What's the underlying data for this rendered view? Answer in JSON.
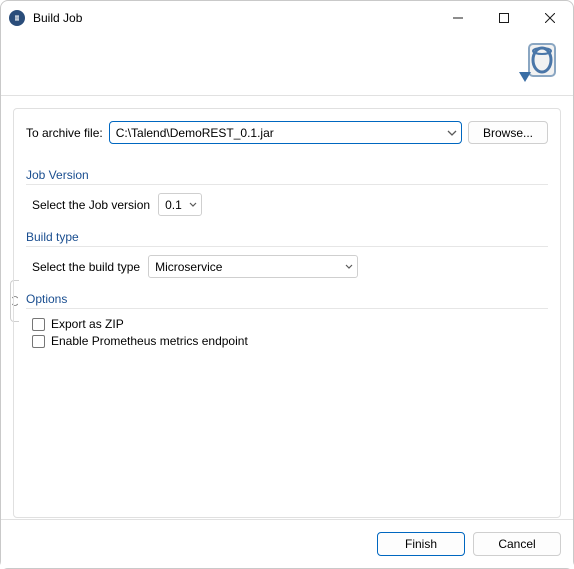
{
  "window": {
    "title": "Build Job"
  },
  "archive": {
    "label": "To archive file:",
    "value": "C:\\Talend\\DemoREST_0.1.jar",
    "browse_label": "Browse..."
  },
  "groups": {
    "job_version": {
      "title": "Job Version",
      "label": "Select the Job version",
      "value": "0.1"
    },
    "build_type": {
      "title": "Build type",
      "label": "Select the build type",
      "value": "Microservice"
    },
    "options": {
      "title": "Options",
      "export_zip": "Export as ZIP",
      "prometheus": "Enable Prometheus metrics endpoint"
    }
  },
  "footer": {
    "finish": "Finish",
    "cancel": "Cancel"
  }
}
